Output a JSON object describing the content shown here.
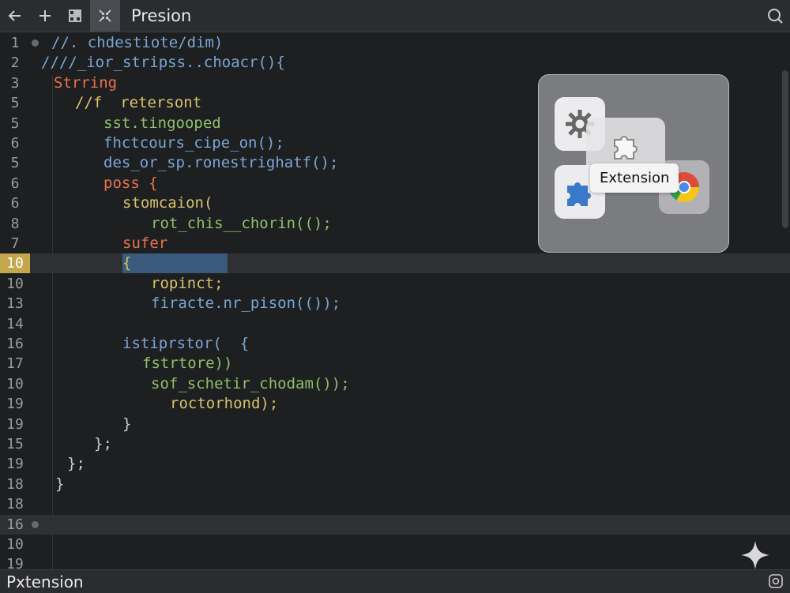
{
  "window": {
    "title": "Presion"
  },
  "icons": {
    "back": "arrow-left-icon",
    "add": "plus-icon",
    "layout": "layout-icon",
    "collapse": "collapse-icon",
    "search": "search-icon",
    "settings": "gear-icon",
    "extension": "puzzle-icon",
    "chrome": "chrome-icon",
    "sparkle": "sparkle-icon",
    "status": "copyright-icon"
  },
  "colors": {
    "background": "#1e1f21",
    "comment_blue": "#7aa6d6",
    "keyword_orange": "#e8734a",
    "string_yellow": "#d7c36a",
    "function_green": "#8fc06a",
    "highlight_gutter": "#c4a64b",
    "selection": "#3a5a7c"
  },
  "editor": {
    "lines": [
      {
        "num": "1",
        "text": "//. chdestiote/dim)",
        "color": "#7aa6d6"
      },
      {
        "num": "2",
        "text": "////_ior_stripss..choacr(){",
        "color": "#7aa6d6"
      },
      {
        "num": "3",
        "text": "Strring",
        "color": "#e8734a"
      },
      {
        "num": "5",
        "text": "//f  retersont",
        "color": "#d7c36a"
      },
      {
        "num": "5",
        "text": "sst.tingooped",
        "color": "#8fc06a"
      },
      {
        "num": "6",
        "text": "fhctcours_cipe_on();",
        "color": "#7aa6d6"
      },
      {
        "num": "5",
        "text": "des_or_sp.ronestrighatf();",
        "color": "#7aa6d6"
      },
      {
        "num": "6",
        "text": "poss {",
        "color": "#e8734a"
      },
      {
        "num": "6",
        "text": "stomcaion(",
        "color": "#d7c36a"
      },
      {
        "num": "8",
        "text": "rot_chis__chorin(();",
        "color": "#8fc06a"
      },
      {
        "num": "7",
        "text": "sufer",
        "color": "#e8734a"
      },
      {
        "num": "10",
        "text": "{",
        "color": "#d7c36a"
      },
      {
        "num": "10",
        "text": "ropinct;",
        "color": "#d7c36a"
      },
      {
        "num": "13",
        "text": "firacte.nr_pison(());",
        "color": "#7aa6d6"
      },
      {
        "num": "14",
        "text": "",
        "color": "#cccccc"
      },
      {
        "num": "16",
        "text": "istiprstor(  {",
        "color": "#7aa6d6"
      },
      {
        "num": "17",
        "text": "fstrtore))",
        "color": "#8fc06a"
      },
      {
        "num": "10",
        "text": "sof_schetir_chodam());",
        "color": "#8fc06a"
      },
      {
        "num": "19",
        "text": "roctorhond);",
        "color": "#d7c36a"
      },
      {
        "num": "19",
        "text": "}",
        "color": "#cccccc"
      },
      {
        "num": "15",
        "text": "};",
        "color": "#cccccc"
      },
      {
        "num": "19",
        "text": "};",
        "color": "#cccccc"
      },
      {
        "num": "18",
        "text": "}",
        "color": "#cccccc"
      },
      {
        "num": "18",
        "text": "",
        "color": "#cccccc"
      },
      {
        "num": "16",
        "text": "",
        "color": "#cccccc"
      },
      {
        "num": "10",
        "text": "",
        "color": "#cccccc"
      },
      {
        "num": "19",
        "text": "",
        "color": "#cccccc"
      }
    ]
  },
  "popup": {
    "tooltip": "Extension"
  },
  "status": {
    "text": "Pxtension"
  }
}
